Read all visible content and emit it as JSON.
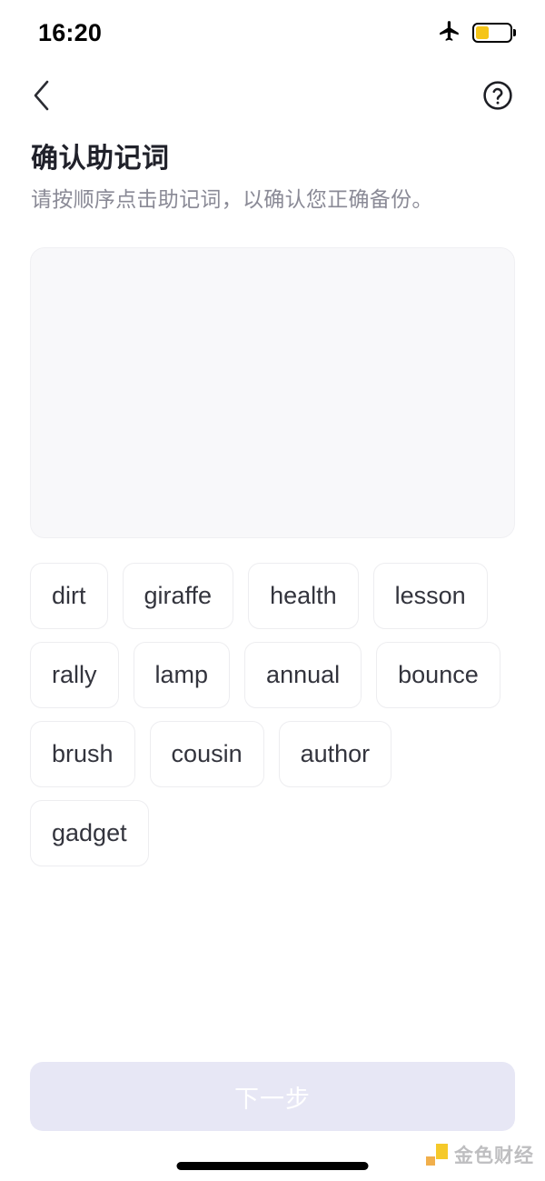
{
  "status_bar": {
    "time": "16:20",
    "airplane_icon": "airplane-mode-icon",
    "battery_icon": "battery-icon",
    "battery_level_percent": 40,
    "battery_color": "#f5c518"
  },
  "nav": {
    "back_icon": "chevron-left-icon",
    "help_icon": "question-mark-circle-icon"
  },
  "heading": {
    "title": "确认助记词",
    "subtitle": "请按顺序点击助记词，以确认您正确备份。"
  },
  "answer_panel": {
    "selected_words": []
  },
  "word_bank": {
    "words": [
      "dirt",
      "giraffe",
      "health",
      "lesson",
      "rally",
      "lamp",
      "annual",
      "bounce",
      "brush",
      "cousin",
      "author",
      "gadget"
    ]
  },
  "footer": {
    "next_label": "下一步",
    "next_disabled": true,
    "next_bg_color": "#e7e7f5",
    "next_text_color": "#ffffff"
  },
  "watermark": {
    "text": "金色财经",
    "logo_icon": "jinse-logo-icon",
    "accent_color": "#f5c518"
  }
}
